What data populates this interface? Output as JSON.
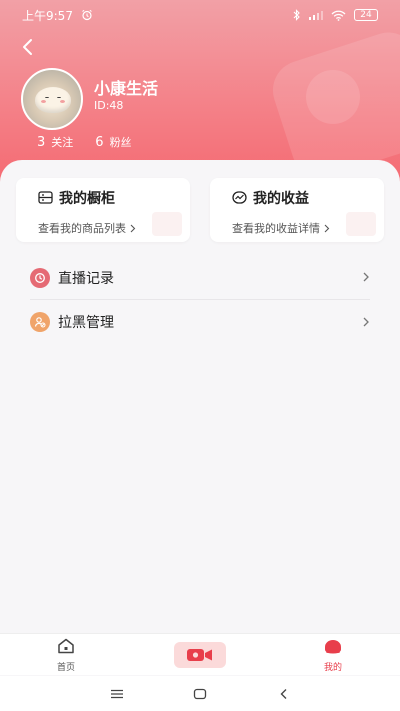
{
  "status_bar": {
    "time": "上午9:57",
    "battery": "24"
  },
  "profile": {
    "name": "小康生活",
    "id_text": "ID:48",
    "follow_count": "3",
    "follow_label": "关注",
    "fans_count": "6",
    "fans_label": "粉丝"
  },
  "cards": {
    "cabinet": {
      "title": "我的橱柜",
      "subtitle": "查看我的商品列表"
    },
    "earnings": {
      "title": "我的收益",
      "subtitle": "查看我的收益详情"
    }
  },
  "menu": {
    "items": [
      {
        "label": "直播记录",
        "icon": "clock-icon",
        "color": "#e56a74"
      },
      {
        "label": "拉黑管理",
        "icon": "user-block-icon",
        "color": "#f0a46a"
      }
    ]
  },
  "tab_bar": {
    "home_label": "首页",
    "mine_label": "我的",
    "accent": "#e83e4b"
  },
  "colors": {
    "header_top": "#f2a0a6",
    "header_bottom": "#f56a72"
  }
}
